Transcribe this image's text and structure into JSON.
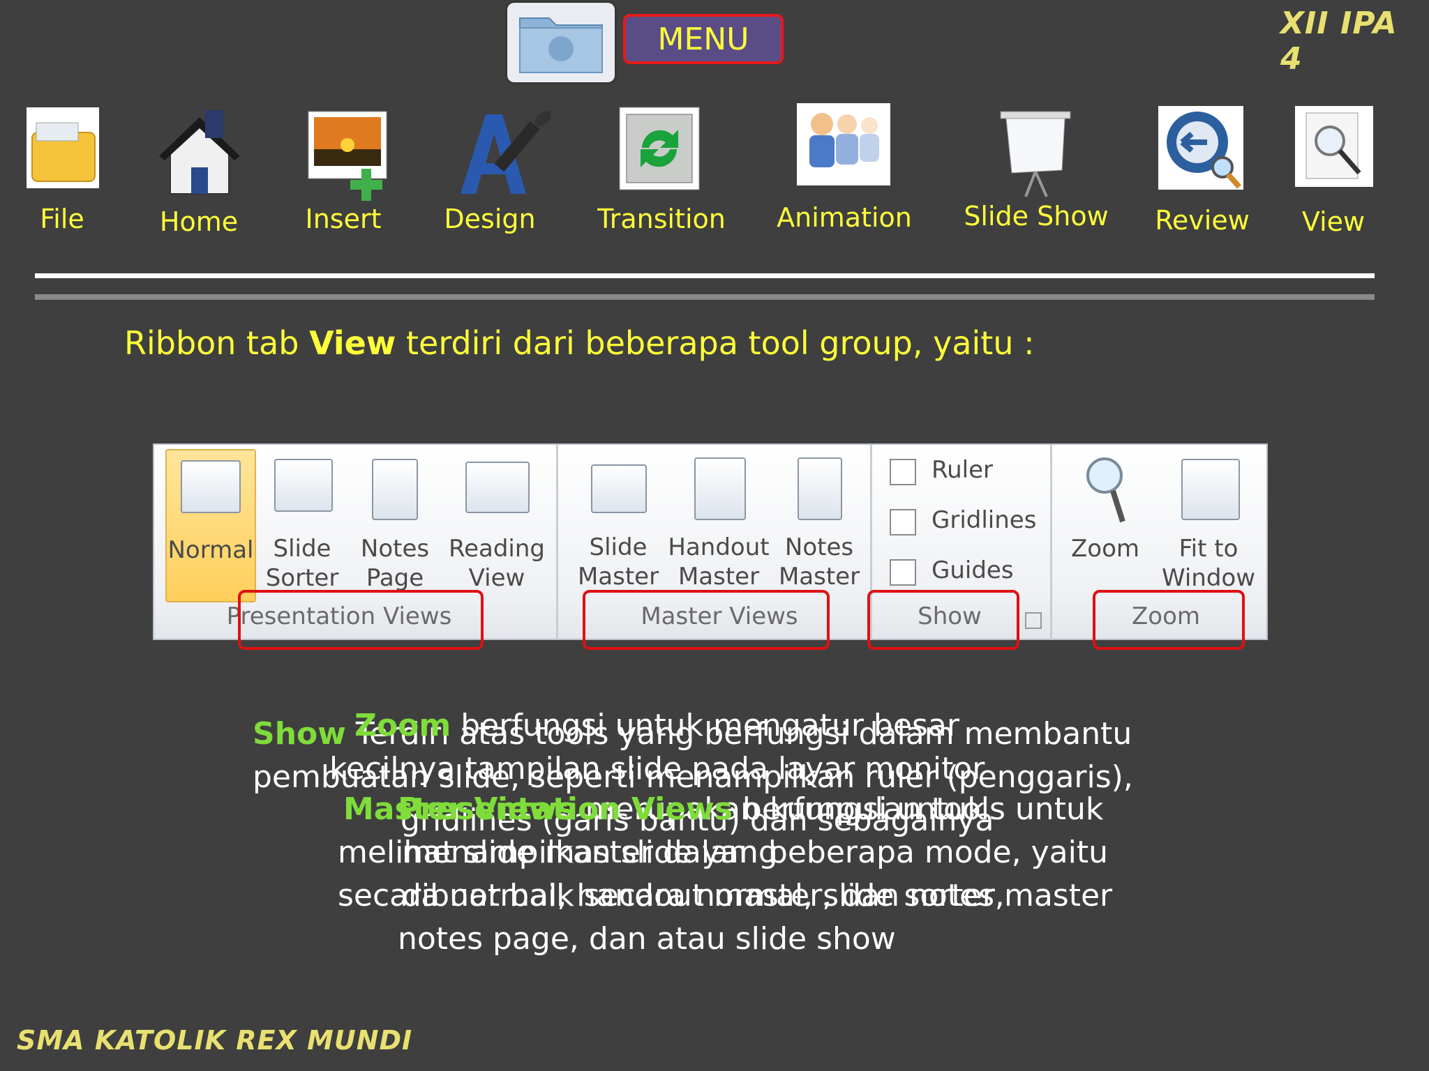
{
  "header": {
    "menu_label": "MENU",
    "class_badge": "XII IPA 4",
    "folder_icon": "folder-user-icon"
  },
  "tabs": [
    {
      "label": "File",
      "icon": "folder-icon"
    },
    {
      "label": "Home",
      "icon": "house-icon"
    },
    {
      "label": "Insert",
      "icon": "insert-picture-icon"
    },
    {
      "label": "Design",
      "icon": "design-brush-icon"
    },
    {
      "label": "Transition",
      "icon": "transition-arrows-icon"
    },
    {
      "label": "Animation",
      "icon": "animation-people-icon"
    },
    {
      "label": "Slide Show",
      "icon": "projector-screen-icon"
    },
    {
      "label": "Review",
      "icon": "review-magnifier-icon"
    },
    {
      "label": "View",
      "icon": "view-document-icon"
    }
  ],
  "intro": {
    "before": "Ribbon tab ",
    "bold": "View",
    "after": " terdiri dari beberapa tool group, yaitu :"
  },
  "ribbon": {
    "presentation_views": {
      "label": "Presentation Views",
      "buttons": [
        {
          "line1": "Normal",
          "line2": ""
        },
        {
          "line1": "Slide",
          "line2": "Sorter"
        },
        {
          "line1": "Notes",
          "line2": "Page"
        },
        {
          "line1": "Reading",
          "line2": "View"
        }
      ]
    },
    "master_views": {
      "label": "Master Views",
      "buttons": [
        {
          "line1": "Slide",
          "line2": "Master"
        },
        {
          "line1": "Handout",
          "line2": "Master"
        },
        {
          "line1": "Notes",
          "line2": "Master"
        }
      ]
    },
    "show": {
      "label": "Show",
      "checkboxes": [
        "Ruler",
        "Gridlines",
        "Guides"
      ]
    },
    "zoom": {
      "label": "Zoom",
      "buttons": [
        {
          "line1": "Zoom",
          "line2": ""
        },
        {
          "line1": "Fit to",
          "line2": "Window"
        }
      ]
    }
  },
  "descriptions": {
    "show": {
      "keyword": "Show",
      "line1": " Terdiri atas tools yang berfungsi dalam membantu",
      "line2": "pembuatan slide, seperti menampilkan ruler (penggaris),",
      "line3": "gridlines (garis bantu) dan sebagainya"
    },
    "zoom": {
      "keyword": "Zoom",
      "line1": " berfungsi untuk mengatur besar",
      "line2": "kecilnya tampilan slide pada layar monitor"
    },
    "master_views": {
      "keyword": "Master Views",
      "line1": " merupakan kumpulan tools untuk",
      "line2": "melihat slide master dalam beberapa mode, yaitu",
      "line3": "secara normal, handout master, dan notes master"
    },
    "presentation_views": {
      "keyword": "Presentation Views",
      "line1": " berfungsi untuk",
      "line2": "menampilkan slide yang",
      "line3": "dibuat baik secara normal, slide sorter,",
      "line4": "notes page, dan atau slide show"
    }
  },
  "footer": {
    "school_name": "SMA KATOLIK REX MUNDI"
  },
  "colors": {
    "background": "#3f3f3f",
    "accent_yellow": "#ffff3a",
    "keyword_green": "#7fdc3a",
    "highlight_red": "#e01010",
    "menu_purple": "#5a4d86"
  }
}
